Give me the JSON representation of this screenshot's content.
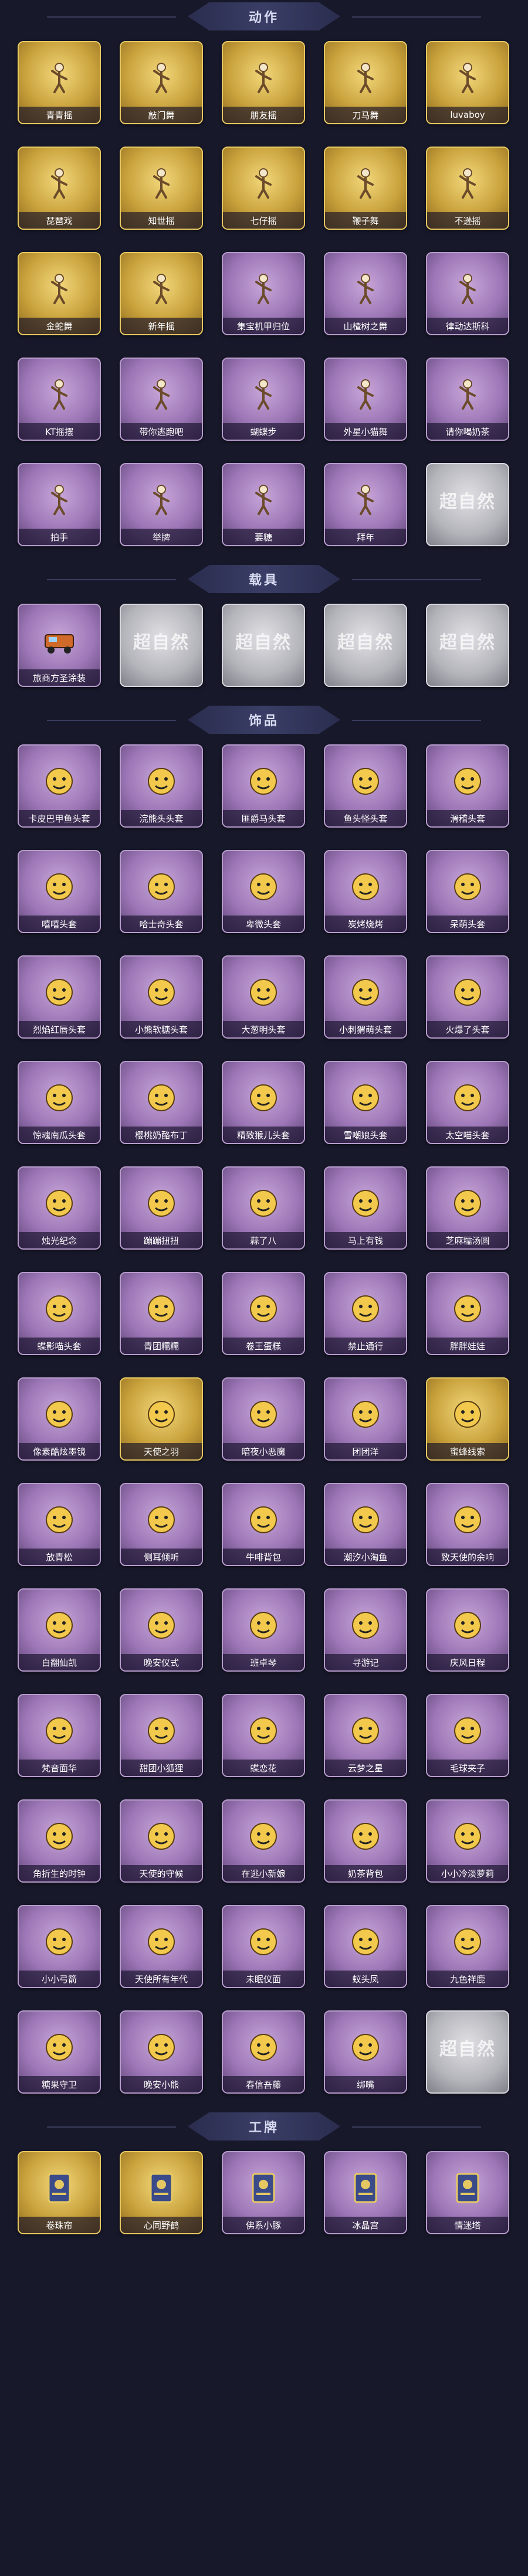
{
  "sections": [
    {
      "title": "动作",
      "items": [
        {
          "label": "青青摇",
          "style": "gold",
          "icon": "dance-pose-icon"
        },
        {
          "label": "敲门舞",
          "style": "gold",
          "icon": "dance-pose-icon"
        },
        {
          "label": "朋友摇",
          "style": "gold",
          "icon": "dance-pose-icon"
        },
        {
          "label": "刀马舞",
          "style": "gold",
          "icon": "dance-pose-icon"
        },
        {
          "label": "luvaboy",
          "style": "gold",
          "icon": "dance-pose-icon"
        },
        {
          "label": "琵琶戏",
          "style": "gold",
          "icon": "dance-pose-icon"
        },
        {
          "label": "知世摇",
          "style": "gold",
          "icon": "dance-pose-icon"
        },
        {
          "label": "七仔摇",
          "style": "gold",
          "icon": "dance-pose-icon"
        },
        {
          "label": "鞭子舞",
          "style": "gold",
          "icon": "dance-pose-icon"
        },
        {
          "label": "不逊摇",
          "style": "gold",
          "icon": "dance-pose-icon"
        },
        {
          "label": "金蛇舞",
          "style": "gold",
          "icon": "dance-pose-icon"
        },
        {
          "label": "新年摇",
          "style": "gold",
          "icon": "dance-pose-icon"
        },
        {
          "label": "集宝机甲归位",
          "style": "purple",
          "icon": "dance-pose-icon"
        },
        {
          "label": "山楂树之舞",
          "style": "purple",
          "icon": "dance-pose-icon"
        },
        {
          "label": "律动达斯科",
          "style": "purple",
          "icon": "dance-pose-icon"
        },
        {
          "label": "KT摇摆",
          "style": "purple",
          "icon": "dance-pose-icon"
        },
        {
          "label": "带你逃跑吧",
          "style": "purple",
          "icon": "dance-pose-icon"
        },
        {
          "label": "蝴蝶步",
          "style": "purple",
          "icon": "dance-pose-icon"
        },
        {
          "label": "外星小猫舞",
          "style": "purple",
          "icon": "dance-pose-icon"
        },
        {
          "label": "请你喝奶茶",
          "style": "purple",
          "icon": "dance-pose-icon"
        },
        {
          "label": "拍手",
          "style": "purple",
          "icon": "dance-pose-icon"
        },
        {
          "label": "举牌",
          "style": "purple",
          "icon": "dance-pose-icon"
        },
        {
          "label": "要糖",
          "style": "purple",
          "icon": "dance-pose-icon"
        },
        {
          "label": "拜年",
          "style": "purple",
          "icon": "dance-pose-icon"
        },
        {
          "label": "",
          "style": "grey",
          "placeholder": "超自然"
        }
      ]
    },
    {
      "title": "载具",
      "items": [
        {
          "label": "旅商方圣涂装",
          "style": "purple",
          "icon": "vehicle-icon"
        },
        {
          "label": "",
          "style": "grey",
          "placeholder": "超自然"
        },
        {
          "label": "",
          "style": "grey",
          "placeholder": "超自然"
        },
        {
          "label": "",
          "style": "grey",
          "placeholder": "超自然"
        },
        {
          "label": "",
          "style": "grey",
          "placeholder": "超自然"
        }
      ]
    },
    {
      "title": "饰品",
      "items": [
        {
          "label": "卡皮巴甲鱼头套",
          "style": "purple",
          "icon": "headgear-icon"
        },
        {
          "label": "浣熊头头套",
          "style": "purple",
          "icon": "headgear-icon"
        },
        {
          "label": "匪爵马头套",
          "style": "purple",
          "icon": "headgear-icon"
        },
        {
          "label": "鱼头怪头套",
          "style": "purple",
          "icon": "headgear-icon"
        },
        {
          "label": "滑稽头套",
          "style": "purple",
          "icon": "headgear-icon"
        },
        {
          "label": "嘻嘻头套",
          "style": "purple",
          "icon": "headgear-icon"
        },
        {
          "label": "哈士奇头套",
          "style": "purple",
          "icon": "headgear-icon"
        },
        {
          "label": "卑微头套",
          "style": "purple",
          "icon": "headgear-icon"
        },
        {
          "label": "炭烤烧烤",
          "style": "purple",
          "icon": "headgear-icon"
        },
        {
          "label": "呆萌头套",
          "style": "purple",
          "icon": "headgear-icon"
        },
        {
          "label": "烈焰红唇头套",
          "style": "purple",
          "icon": "headgear-icon"
        },
        {
          "label": "小熊软糖头套",
          "style": "purple",
          "icon": "headgear-icon"
        },
        {
          "label": "大葱明头套",
          "style": "purple",
          "icon": "headgear-icon"
        },
        {
          "label": "小刺猬萌头套",
          "style": "purple",
          "icon": "headgear-icon"
        },
        {
          "label": "火爆了头套",
          "style": "purple",
          "icon": "headgear-icon"
        },
        {
          "label": "惊魂南瓜头套",
          "style": "purple",
          "icon": "headgear-icon"
        },
        {
          "label": "樱桃奶酪布丁",
          "style": "purple",
          "icon": "headgear-icon"
        },
        {
          "label": "精致猴儿头套",
          "style": "purple",
          "icon": "headgear-icon"
        },
        {
          "label": "雪嘲娘头套",
          "style": "purple",
          "icon": "headgear-icon"
        },
        {
          "label": "太空喵头套",
          "style": "purple",
          "icon": "headgear-icon"
        },
        {
          "label": "烛光纪念",
          "style": "purple",
          "icon": "headgear-icon"
        },
        {
          "label": "蹦蹦扭扭",
          "style": "purple",
          "icon": "headgear-icon"
        },
        {
          "label": "蒜了八",
          "style": "purple",
          "icon": "headgear-icon"
        },
        {
          "label": "马上有钱",
          "style": "purple",
          "icon": "headgear-icon"
        },
        {
          "label": "芝麻糯汤圆",
          "style": "purple",
          "icon": "headgear-icon"
        },
        {
          "label": "蝶影喵头套",
          "style": "purple",
          "icon": "headgear-icon"
        },
        {
          "label": "青团糯糯",
          "style": "purple",
          "icon": "headgear-icon"
        },
        {
          "label": "卷王蛋糕",
          "style": "purple",
          "icon": "headgear-icon"
        },
        {
          "label": "禁止通行",
          "style": "purple",
          "icon": "headgear-icon"
        },
        {
          "label": "胖胖娃娃",
          "style": "purple",
          "icon": "headgear-icon"
        },
        {
          "label": "像素酷炫墨镜",
          "style": "purple",
          "icon": "headgear-icon"
        },
        {
          "label": "天使之羽",
          "style": "gold",
          "icon": "headgear-icon"
        },
        {
          "label": "暗夜小恶魔",
          "style": "purple",
          "icon": "headgear-icon"
        },
        {
          "label": "团团洋",
          "style": "purple",
          "icon": "headgear-icon"
        },
        {
          "label": "蜜蜂线索",
          "style": "gold",
          "icon": "headgear-icon"
        },
        {
          "label": "放青松",
          "style": "purple",
          "icon": "headgear-icon"
        },
        {
          "label": "侧耳倾听",
          "style": "purple",
          "icon": "headgear-icon"
        },
        {
          "label": "牛啡背包",
          "style": "purple",
          "icon": "headgear-icon"
        },
        {
          "label": "潮汐小淘鱼",
          "style": "purple",
          "icon": "headgear-icon"
        },
        {
          "label": "致天使的余响",
          "style": "purple",
          "icon": "headgear-icon"
        },
        {
          "label": "白翻仙凯",
          "style": "purple",
          "icon": "headgear-icon"
        },
        {
          "label": "晚安仪式",
          "style": "purple",
          "icon": "headgear-icon"
        },
        {
          "label": "班卓琴",
          "style": "purple",
          "icon": "headgear-icon"
        },
        {
          "label": "寻游记",
          "style": "purple",
          "icon": "headgear-icon"
        },
        {
          "label": "庆风日程",
          "style": "purple",
          "icon": "headgear-icon"
        },
        {
          "label": "梵音面华",
          "style": "purple",
          "icon": "headgear-icon"
        },
        {
          "label": "甜团小狐狸",
          "style": "purple",
          "icon": "headgear-icon"
        },
        {
          "label": "蝶恋花",
          "style": "purple",
          "icon": "headgear-icon"
        },
        {
          "label": "云梦之星",
          "style": "purple",
          "icon": "headgear-icon"
        },
        {
          "label": "毛球夹子",
          "style": "purple",
          "icon": "headgear-icon"
        },
        {
          "label": "角折生的时钟",
          "style": "purple",
          "icon": "headgear-icon"
        },
        {
          "label": "天使的守候",
          "style": "purple",
          "icon": "headgear-icon"
        },
        {
          "label": "在逃小新娘",
          "style": "purple",
          "icon": "headgear-icon"
        },
        {
          "label": "奶茶背包",
          "style": "purple",
          "icon": "headgear-icon"
        },
        {
          "label": "小小冷淡萝莉",
          "style": "purple",
          "icon": "headgear-icon"
        },
        {
          "label": "小小弓箭",
          "style": "purple",
          "icon": "headgear-icon"
        },
        {
          "label": "天使所有年代",
          "style": "purple",
          "icon": "headgear-icon"
        },
        {
          "label": "未眠仪面",
          "style": "purple",
          "icon": "headgear-icon"
        },
        {
          "label": "蚁头凤",
          "style": "purple",
          "icon": "headgear-icon"
        },
        {
          "label": "九色祥鹿",
          "style": "purple",
          "icon": "headgear-icon"
        },
        {
          "label": "糖果守卫",
          "style": "purple",
          "icon": "headgear-icon"
        },
        {
          "label": "晚安小熊",
          "style": "purple",
          "icon": "headgear-icon"
        },
        {
          "label": "春信吾藤",
          "style": "purple",
          "icon": "headgear-icon"
        },
        {
          "label": "绑嘴",
          "style": "purple",
          "icon": "headgear-icon"
        },
        {
          "label": "",
          "style": "grey",
          "placeholder": "超自然"
        }
      ]
    },
    {
      "title": "工牌",
      "items": [
        {
          "label": "卷珠帘",
          "style": "gold",
          "icon": "badge-card-icon"
        },
        {
          "label": "心同野鹤",
          "style": "gold",
          "icon": "badge-card-icon"
        },
        {
          "label": "佛系小豚",
          "style": "purple",
          "icon": "badge-card-icon"
        },
        {
          "label": "冰晶宫",
          "style": "purple",
          "icon": "badge-card-icon"
        },
        {
          "label": "情迷塔",
          "style": "purple",
          "icon": "badge-card-icon"
        }
      ]
    }
  ]
}
